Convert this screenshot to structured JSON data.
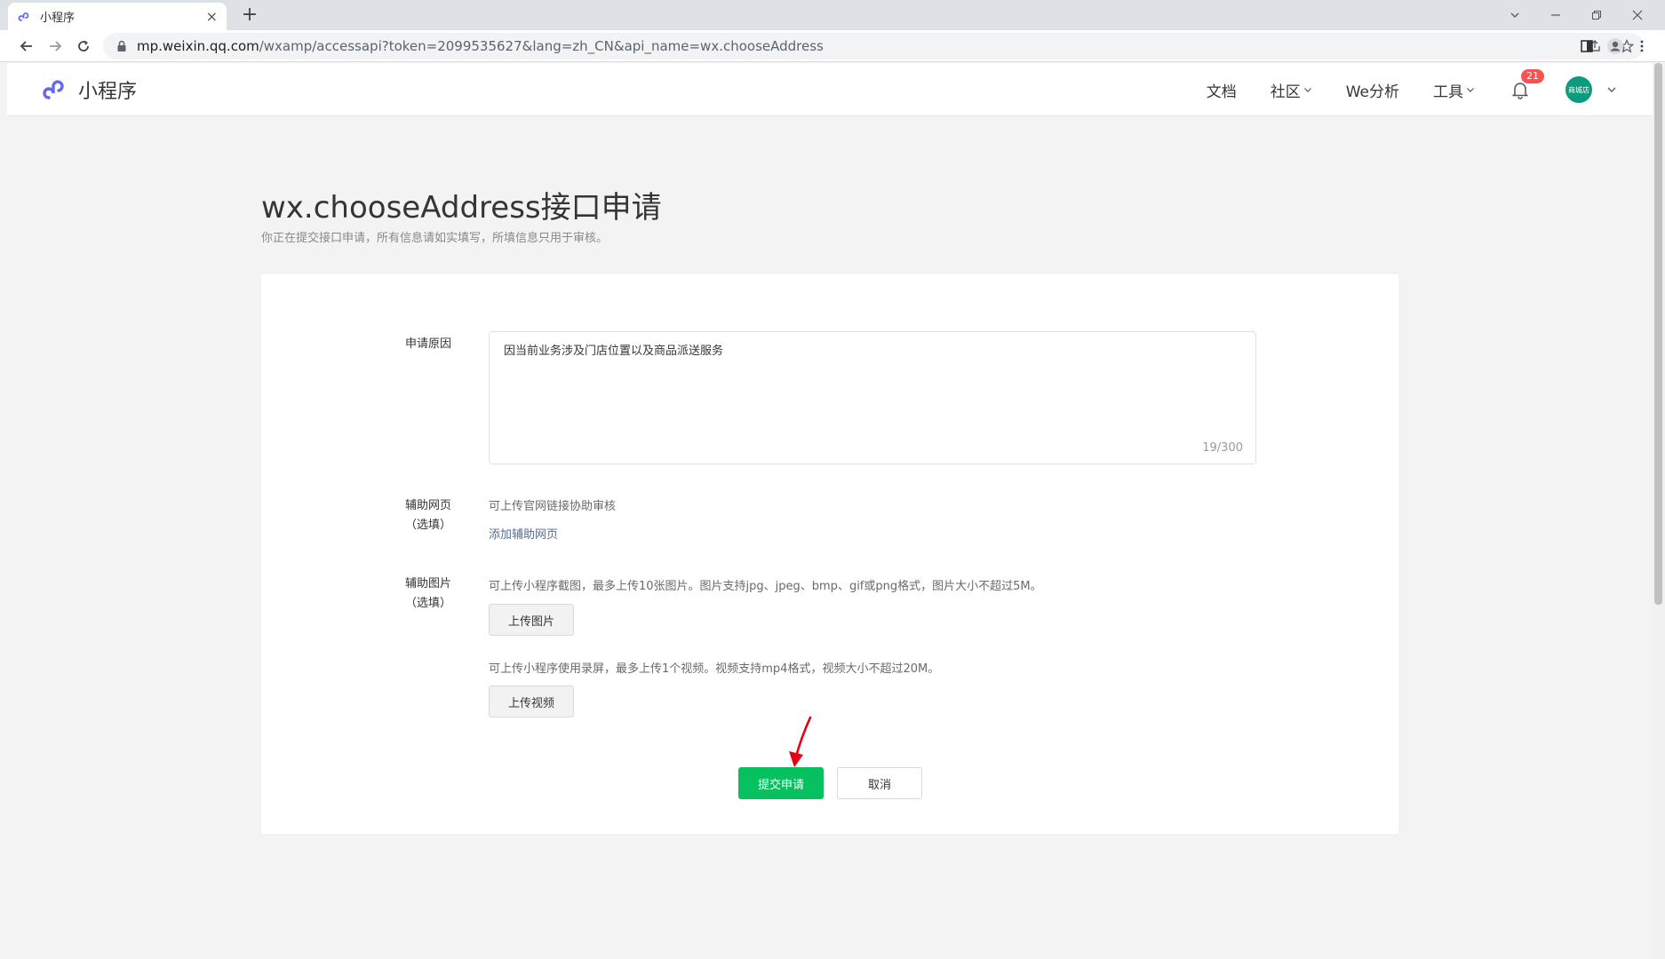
{
  "browser": {
    "tab_title": "小程序",
    "tab_close": "×",
    "new_tab": "+",
    "url_host": "mp.weixin.qq.com",
    "url_rest": "/wxamp/accessapi?token=2099535627&lang=zh_CN&api_name=wx.chooseAddress"
  },
  "header": {
    "brand": "小程序",
    "nav": {
      "docs": "文档",
      "community": "社区",
      "analytics": "We分析",
      "tools": "工具"
    },
    "notification_count": "21",
    "avatar_text": "商城店"
  },
  "main": {
    "title": "wx.chooseAddress接口申请",
    "subtitle": "你正在提交接口申请，所有信息请如实填写，所填信息只用于审核。",
    "reason": {
      "label": "申请原因",
      "value": "因当前业务涉及门店位置以及商品派送服务",
      "counter": "19/300"
    },
    "webpage": {
      "label_line1": "辅助网页",
      "label_line2": "（选填）",
      "tip": "可上传官网链接协助审核",
      "add_link": "添加辅助网页"
    },
    "images": {
      "label_line1": "辅助图片",
      "label_line2": "（选填）",
      "image_tip": "可上传小程序截图，最多上传10张图片。图片支持jpg、jpeg、bmp、gif或png格式，图片大小不超过5M。",
      "upload_image": "上传图片",
      "video_tip": "可上传小程序使用录屏，最多上传1个视频。视频支持mp4格式，视频大小不超过20M。",
      "upload_video": "上传视频"
    },
    "submit": "提交申请",
    "cancel": "取消"
  },
  "colors": {
    "primary": "#07c160",
    "link": "#576b95",
    "badge": "#fa5151",
    "annotation_arrow": "#e60012"
  }
}
